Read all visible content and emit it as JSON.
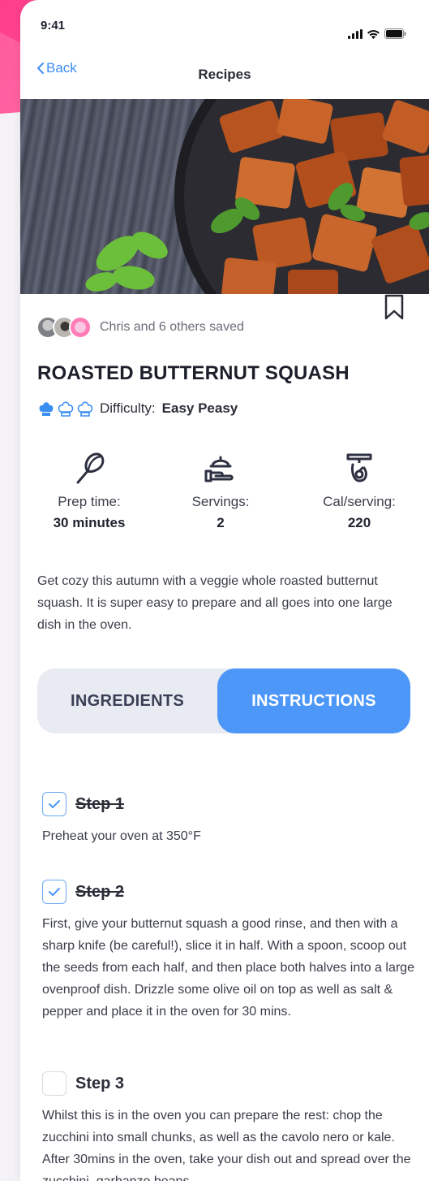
{
  "status_bar": {
    "time": "9:41"
  },
  "nav": {
    "back_label": "Back",
    "title": "Recipes"
  },
  "social": {
    "saved_text": "Chris and 6 others saved"
  },
  "recipe": {
    "title": "ROASTED BUTTERNUT SQUASH",
    "difficulty_label": "Difficulty:",
    "difficulty_value": "Easy Peasy",
    "difficulty_level": 1,
    "difficulty_max": 3,
    "stats": [
      {
        "icon": "whisk-icon",
        "label": "Prep time:",
        "value": "30 minutes"
      },
      {
        "icon": "serving-hand-icon",
        "label": "Servings:",
        "value": "2"
      },
      {
        "icon": "scale-icon",
        "label": "Cal/serving:",
        "value": "220"
      }
    ],
    "description": "Get cozy this autumn with a veggie whole roasted butternut squash. It is super easy to prepare and all goes into one large dish in the oven."
  },
  "tabs": [
    {
      "label": "INGREDIENTS",
      "active": false
    },
    {
      "label": "INSTRUCTIONS",
      "active": true
    }
  ],
  "steps": [
    {
      "title": "Step 1",
      "done": true,
      "text": "Preheat your oven at 350°F"
    },
    {
      "title": "Step 2",
      "done": true,
      "text": "First, give your butternut squash a good rinse, and then with a sharp knife (be careful!), slice it in half. With a spoon, scoop out the seeds from each half, and then place both halves into a large ovenproof dish. Drizzle some olive oil on top as well as salt & pepper and place it in the oven for 30 mins."
    },
    {
      "title": "Step 3",
      "done": false,
      "text": "Whilst this is in the oven you can prepare the rest: chop the zucchini into small chunks, as well as the cavolo nero or kale. After 30mins in the oven, take your dish out and spread over the zucchini, garbanzo beans,"
    }
  ],
  "colors": {
    "accent": "#4c97f7",
    "brand_pink": "#ff3d8b",
    "text_dark": "#1f2330"
  }
}
